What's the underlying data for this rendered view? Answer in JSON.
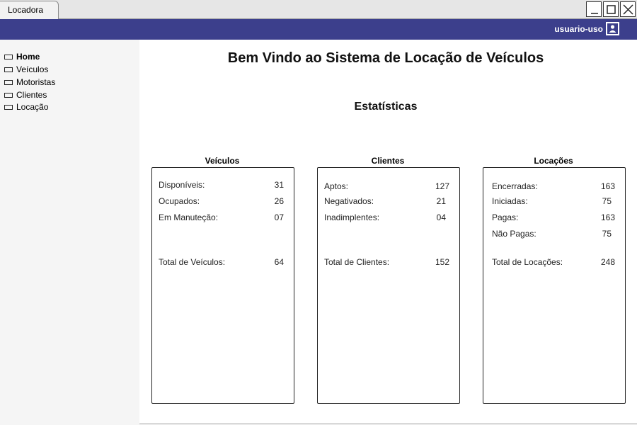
{
  "window": {
    "tab_label": "Locadora",
    "controls": [
      "minimize-icon",
      "maximize-icon",
      "close-icon"
    ]
  },
  "header": {
    "username": "usuario-uso",
    "user_icon": "user-icon",
    "bar_color": "#3c3f8c"
  },
  "sidebar": {
    "items": [
      {
        "label": "Home",
        "active": true
      },
      {
        "label": "Veículos",
        "active": false
      },
      {
        "label": "Motoristas",
        "active": false
      },
      {
        "label": "Clientes",
        "active": false
      },
      {
        "label": "Locação",
        "active": false
      }
    ]
  },
  "main": {
    "title": "Bem Vindo ao Sistema de Locação de Veículos",
    "section_title": "Estatísticas",
    "cards": [
      {
        "title": "Veículos",
        "rows": [
          {
            "label": "Disponíveis:",
            "value": "31"
          },
          {
            "label": "Ocupados:",
            "value": "26"
          },
          {
            "label": "Em Manuteção:",
            "value": "07"
          }
        ],
        "total": {
          "label": "Total de Veículos:",
          "value": "64"
        }
      },
      {
        "title": "Clientes",
        "rows": [
          {
            "label": "Aptos:",
            "value": "127"
          },
          {
            "label": "Negativados:",
            "value": "21"
          },
          {
            "label": "Inadimplentes:",
            "value": "04"
          }
        ],
        "total": {
          "label": "Total de Clientes:",
          "value": "152"
        }
      },
      {
        "title": "Locações",
        "rows": [
          {
            "label": "Encerradas:",
            "value": "163"
          },
          {
            "label": "Iniciadas:",
            "value": "75"
          },
          {
            "label": "Pagas:",
            "value": "163"
          },
          {
            "label": "Não Pagas:",
            "value": "75"
          }
        ],
        "total": {
          "label": "Total de Locações:",
          "value": "248"
        }
      }
    ]
  }
}
